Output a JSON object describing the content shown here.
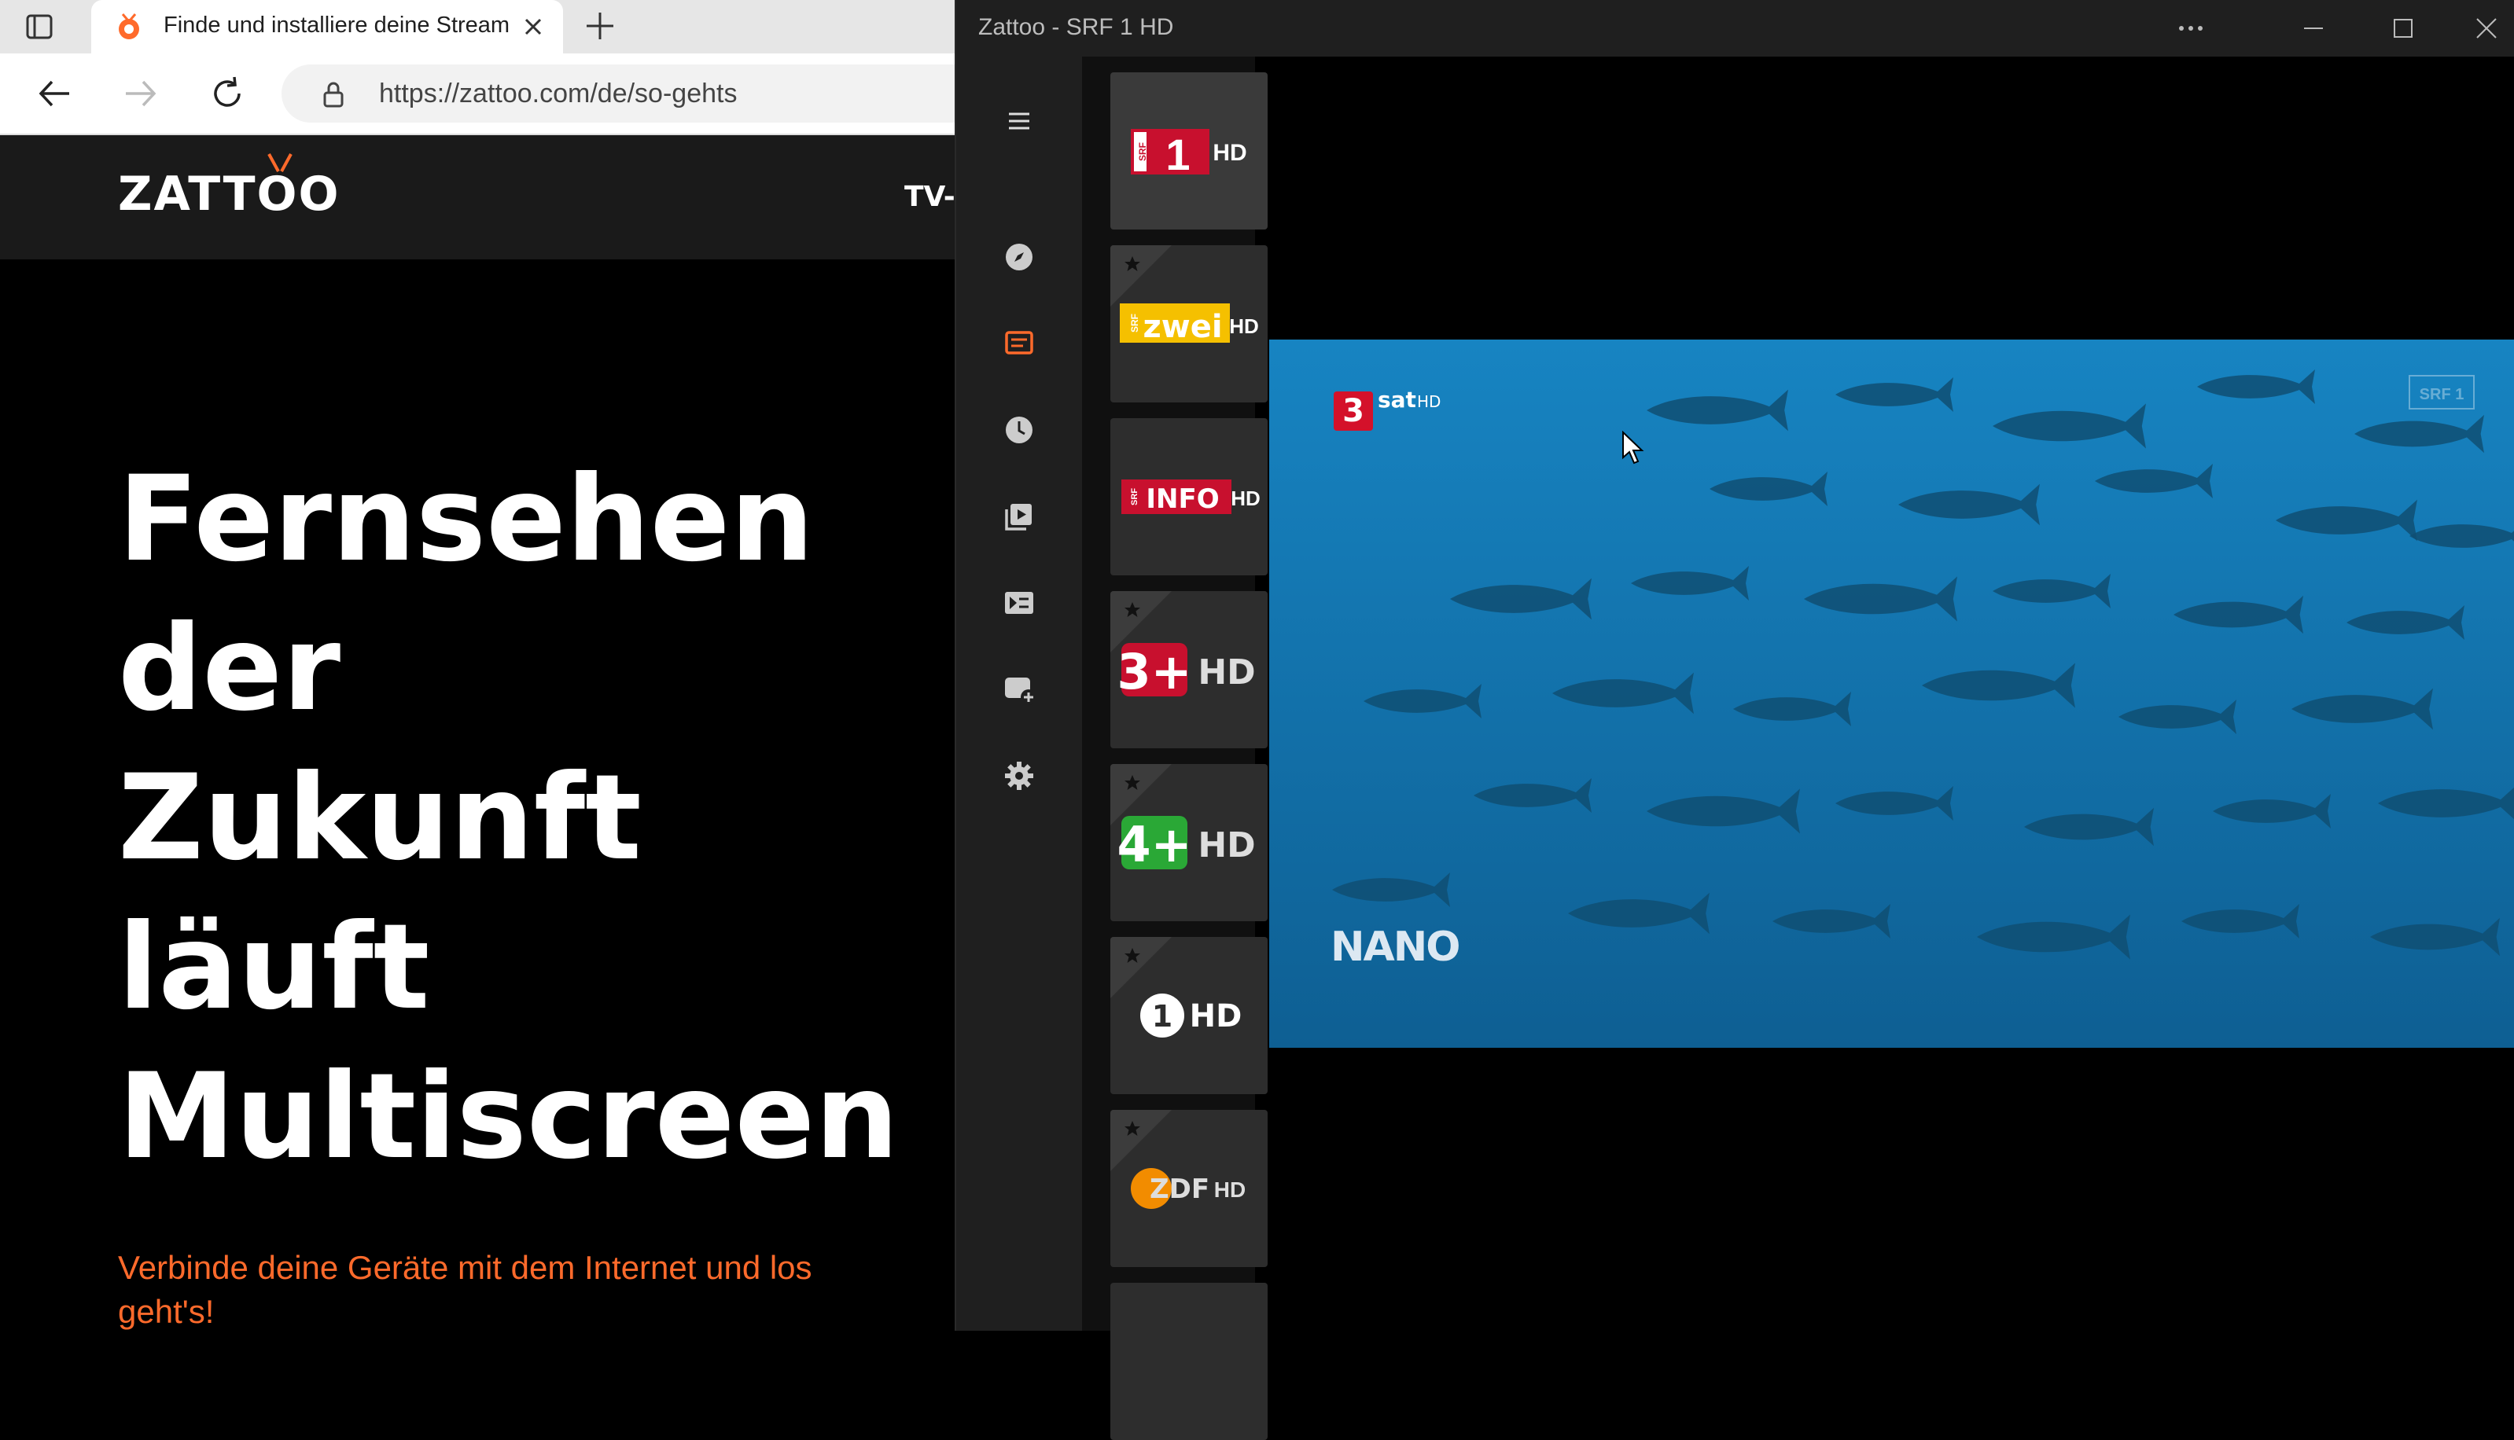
{
  "browser": {
    "tab": {
      "title": "Finde und installiere deine Streaming"
    },
    "address": {
      "url": "https://zattoo.com/de/so-gehts"
    },
    "icons": [
      "tab-actions-icon",
      "zattoo-favicon",
      "close-icon",
      "plus-icon",
      "back-arrow-icon",
      "forward-arrow-icon",
      "refresh-icon",
      "lock-icon"
    ]
  },
  "site": {
    "logo": "ZATTOO",
    "nav_partial": "TV-S",
    "hero": {
      "lines": [
        "Fernsehen",
        "der",
        "Zukunft",
        "läuft",
        "Multiscreen"
      ],
      "subtitle": "Verbinde deine Geräte mit dem Internet und los geht's!"
    },
    "colors": {
      "accent": "#ff6a2b",
      "header_bg": "#1a1a1a"
    }
  },
  "app": {
    "title": "Zattoo - SRF 1 HD",
    "sidebar_icons": [
      "menu-icon",
      "compass-icon",
      "live-tv-icon",
      "clock-icon",
      "recordings-icon",
      "vod-icon",
      "add-channel-icon",
      "settings-icon"
    ],
    "active_sidebar": "live-tv-icon",
    "accent": "#ff6a2b",
    "channels": [
      {
        "name": "SRF 1 HD",
        "logo_text": "1",
        "hd": "HD",
        "favorite": false,
        "active": true
      },
      {
        "name": "SRF zwei HD",
        "logo_text": "zwei",
        "hd": "HD",
        "favorite": true
      },
      {
        "name": "SRF info HD",
        "logo_text": "INFO",
        "hd": "HD",
        "favorite": false
      },
      {
        "name": "3+ HD",
        "logo_text": "3+",
        "hd": "HD",
        "favorite": true
      },
      {
        "name": "4+ HD",
        "logo_text": "4+",
        "hd": "HD",
        "favorite": true
      },
      {
        "name": "Das Erste HD",
        "logo_text": "1",
        "hd": "HD",
        "favorite": true
      },
      {
        "name": "ZDF HD",
        "logo_text": "ZDF",
        "hd": "HD",
        "favorite": true
      }
    ],
    "video": {
      "channel_bug": "sat",
      "channel_bug_hd": "HD",
      "bug_number": "3",
      "show_logo": "NANO",
      "watermark": "SRF 1"
    }
  }
}
